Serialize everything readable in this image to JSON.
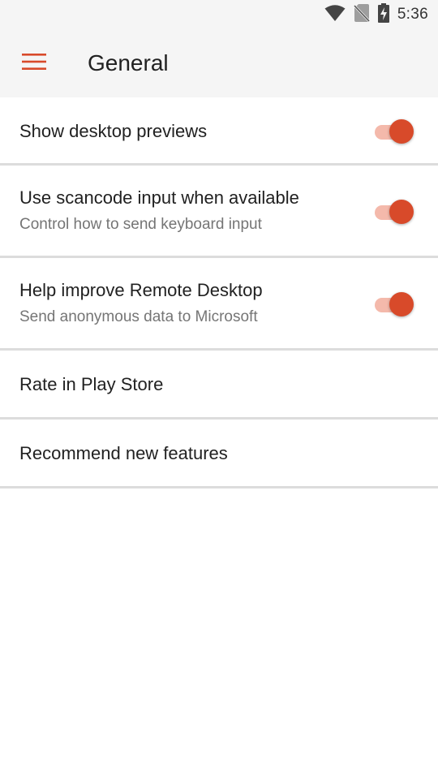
{
  "status_bar": {
    "time": "5:36",
    "icons": [
      "wifi-icon",
      "no-sim-icon",
      "battery-charging-icon"
    ]
  },
  "app_bar": {
    "title": "General",
    "menu_icon": "hamburger-menu-icon"
  },
  "colors": {
    "accent": "#d84a2a",
    "toggle_track_on": "#f4b9ab",
    "app_bar_bg": "#f5f5f5",
    "divider": "#dcdcdc"
  },
  "settings": [
    {
      "title": "Show desktop previews",
      "subtitle": "",
      "toggle": true
    },
    {
      "title": "Use scancode input when available",
      "subtitle": "Control how to send keyboard input",
      "toggle": true
    },
    {
      "title": "Help improve Remote Desktop",
      "subtitle": "Send anonymous data to Microsoft",
      "toggle": true
    },
    {
      "title": "Rate in Play Store",
      "subtitle": "",
      "toggle": null
    },
    {
      "title": "Recommend new features",
      "subtitle": "",
      "toggle": null
    }
  ]
}
